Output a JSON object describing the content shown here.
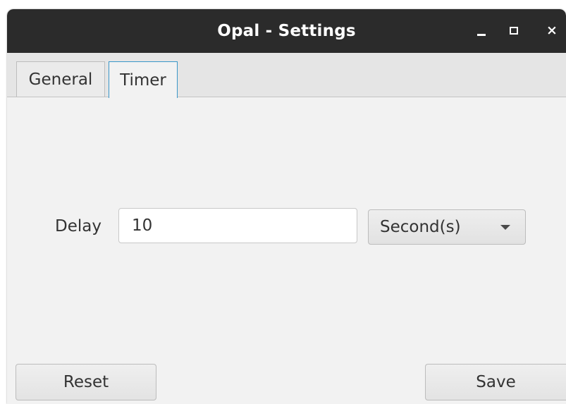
{
  "window": {
    "title": "Opal - Settings",
    "controls": {
      "minimize": "minimize-icon",
      "maximize": "maximize-icon",
      "close": "close-icon",
      "close_glyph": "×"
    }
  },
  "tabs": [
    {
      "label": "General",
      "selected": false
    },
    {
      "label": "Timer",
      "selected": true
    }
  ],
  "timer": {
    "delay_label": "Delay",
    "delay_value": "10",
    "unit_selected": "Second(s)"
  },
  "buttons": {
    "reset_label": "Reset",
    "save_label": "Save"
  },
  "colors": {
    "titlebar": "#2b2b2b",
    "selected_tab_border": "#3a97c9",
    "background": "#f2f2f2"
  }
}
